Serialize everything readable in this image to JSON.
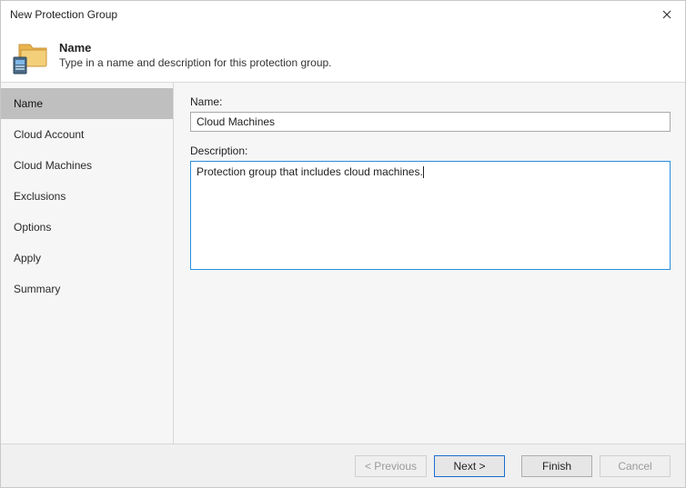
{
  "window": {
    "title": "New Protection Group"
  },
  "header": {
    "title": "Name",
    "subtitle": "Type in a name and description for this protection group."
  },
  "sidebar": {
    "steps": [
      {
        "label": "Name",
        "active": true
      },
      {
        "label": "Cloud Account",
        "active": false
      },
      {
        "label": "Cloud Machines",
        "active": false
      },
      {
        "label": "Exclusions",
        "active": false
      },
      {
        "label": "Options",
        "active": false
      },
      {
        "label": "Apply",
        "active": false
      },
      {
        "label": "Summary",
        "active": false
      }
    ]
  },
  "form": {
    "name_label": "Name:",
    "name_value": "Cloud Machines",
    "description_label": "Description:",
    "description_value": "Protection group that includes cloud machines."
  },
  "buttons": {
    "previous": "< Previous",
    "next": "Next >",
    "finish": "Finish",
    "cancel": "Cancel"
  }
}
